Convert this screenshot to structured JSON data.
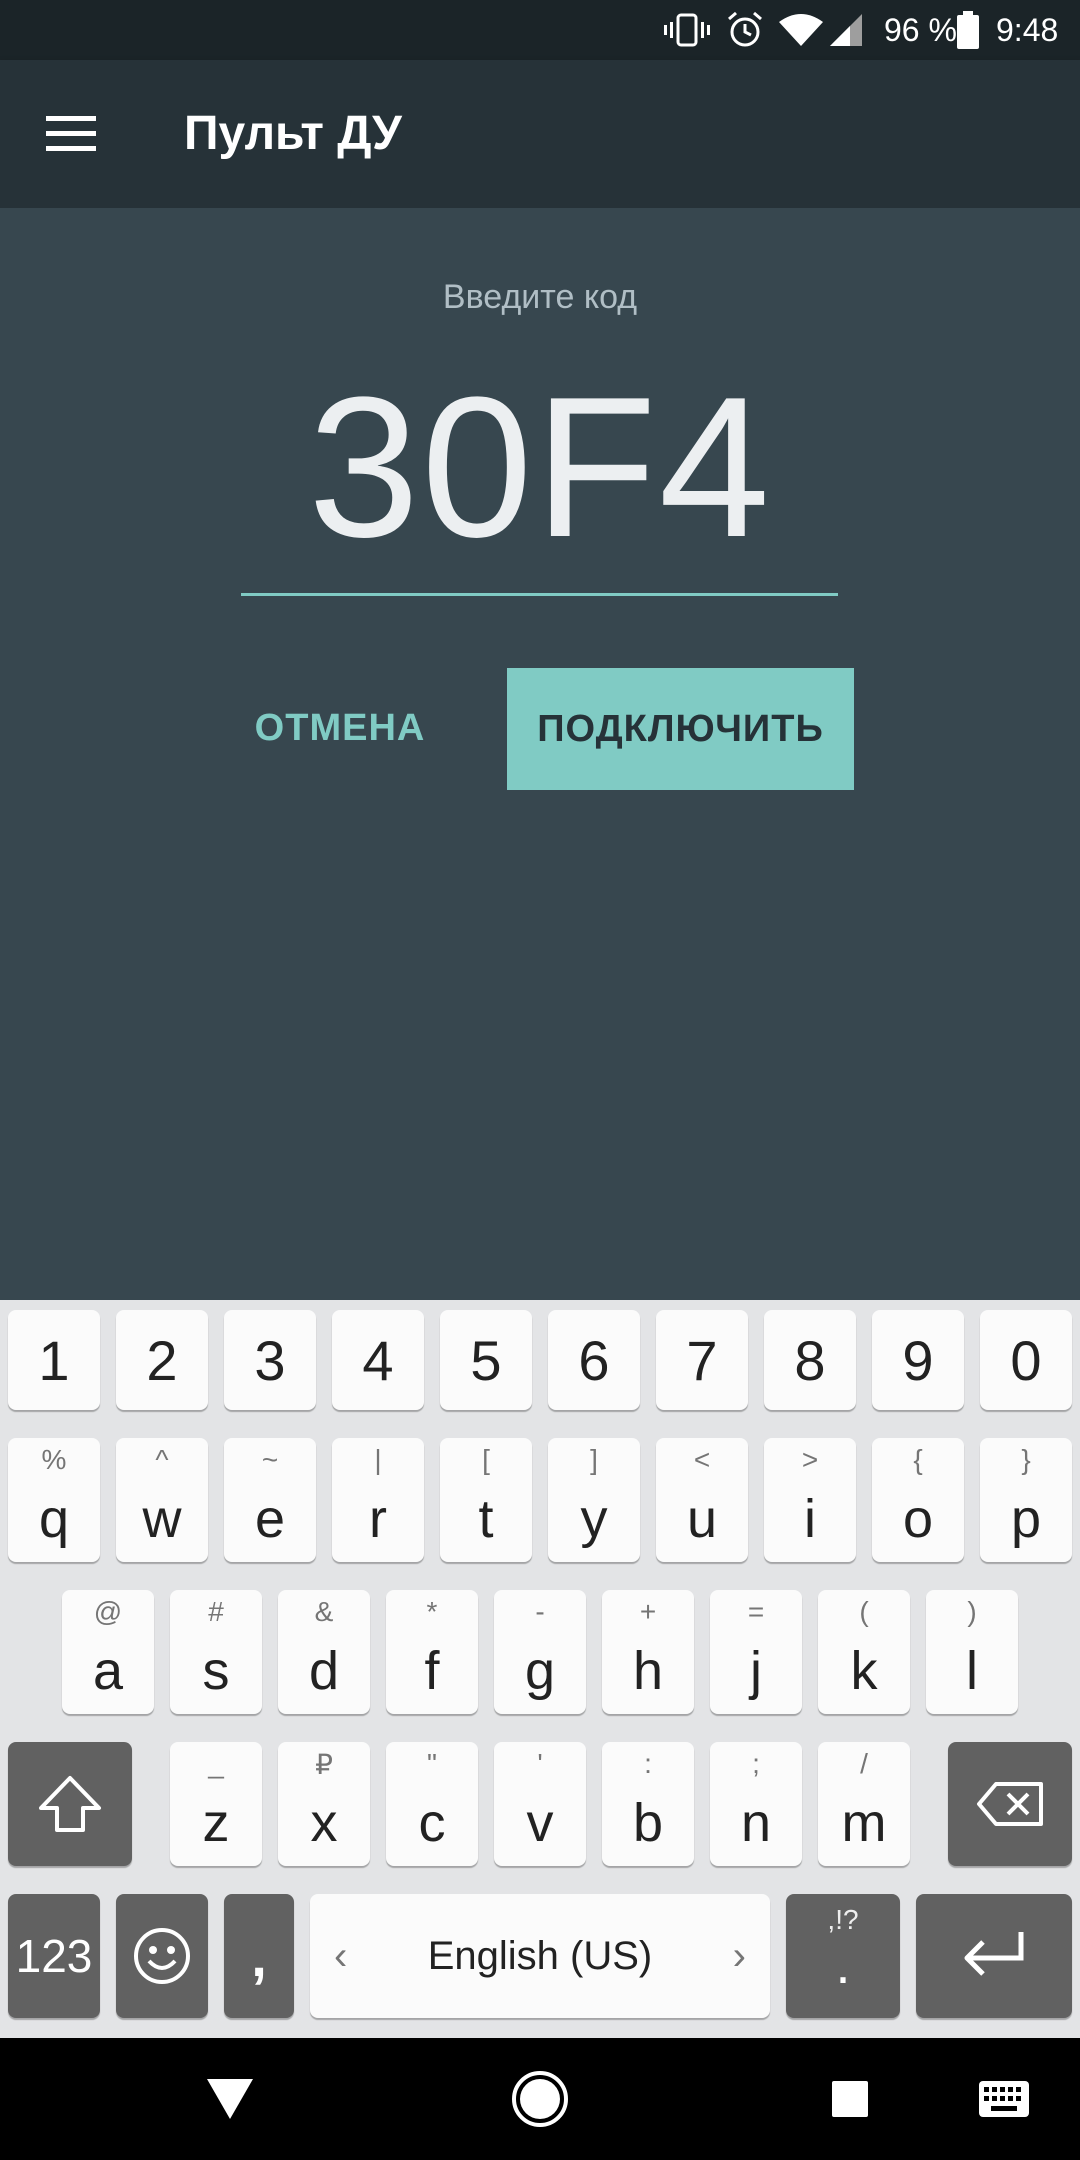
{
  "status_bar": {
    "battery_percent": "96 %",
    "time": "9:48",
    "icons": [
      "vibrate-icon",
      "alarm-icon",
      "wifi-icon",
      "signal-icon",
      "battery-icon"
    ]
  },
  "app_bar": {
    "title": "Пульт ДУ",
    "menu_icon": "menu-icon"
  },
  "pairing": {
    "prompt": "Введите код",
    "code": "30F4",
    "cancel_label": "ОТМЕНА",
    "connect_label": "ПОДКЛЮЧИТЬ"
  },
  "keyboard": {
    "number_row": [
      "1",
      "2",
      "3",
      "4",
      "5",
      "6",
      "7",
      "8",
      "9",
      "0"
    ],
    "row1": [
      {
        "key": "q",
        "hint": "%"
      },
      {
        "key": "w",
        "hint": "^"
      },
      {
        "key": "e",
        "hint": "~"
      },
      {
        "key": "r",
        "hint": "|"
      },
      {
        "key": "t",
        "hint": "["
      },
      {
        "key": "y",
        "hint": "]"
      },
      {
        "key": "u",
        "hint": "<"
      },
      {
        "key": "i",
        "hint": ">"
      },
      {
        "key": "o",
        "hint": "{"
      },
      {
        "key": "p",
        "hint": "}"
      }
    ],
    "row2": [
      {
        "key": "a",
        "hint": "@"
      },
      {
        "key": "s",
        "hint": "#"
      },
      {
        "key": "d",
        "hint": "&"
      },
      {
        "key": "f",
        "hint": "*"
      },
      {
        "key": "g",
        "hint": "-"
      },
      {
        "key": "h",
        "hint": "+"
      },
      {
        "key": "j",
        "hint": "="
      },
      {
        "key": "k",
        "hint": "("
      },
      {
        "key": "l",
        "hint": ")"
      }
    ],
    "row3": [
      {
        "key": "z",
        "hint": "_"
      },
      {
        "key": "x",
        "hint": "₽"
      },
      {
        "key": "c",
        "hint": "\""
      },
      {
        "key": "v",
        "hint": "'"
      },
      {
        "key": "b",
        "hint": ":"
      },
      {
        "key": "n",
        "hint": ";"
      },
      {
        "key": "m",
        "hint": "/"
      }
    ],
    "symbols_label": "123",
    "comma_label": ",",
    "space_label": "English (US)",
    "space_left_arrow": "‹",
    "space_right_arrow": "›",
    "period_label": ".",
    "period_hint": ",!?"
  },
  "nav_bar": {
    "icons": [
      "back-icon",
      "home-icon",
      "recents-icon",
      "keyboard-switch-icon"
    ]
  }
}
